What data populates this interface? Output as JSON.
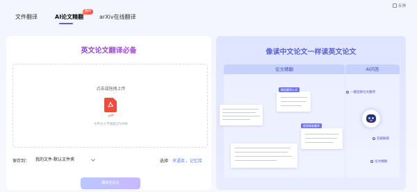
{
  "header": {
    "tabs": [
      {
        "label": "文件翻译"
      },
      {
        "label": "AI论文精翻",
        "active": true
      },
      {
        "label": "arXiv在线翻译"
      }
    ],
    "badge": "限时",
    "feedback": "反馈"
  },
  "left": {
    "title": "英文论文翻译必备",
    "drop_text": "点击或拖拽上传",
    "file_type": "pdf",
    "size_note": "文件大小不能超过50MB",
    "save_label": "保存到：",
    "save_value": "我的文件-默认文件夹",
    "choose_label": "选择",
    "choose_link1": "术语库",
    "choose_link2": "记忆库",
    "translate_button": "翻译全论文"
  },
  "right": {
    "title": "像读中文论文一样读英文论文",
    "translate_header": "论文精翻",
    "qa_header": "AI问答",
    "tag1": "精准翻译公式",
    "tag2": "图表精准翻译",
    "qa_items": [
      "一键选择论文翻译",
      "答疑解惑",
      "论文精翻"
    ]
  },
  "colors": {
    "accent": "#5b5bf0",
    "title_gradient_start": "#7a3cf0",
    "title_gradient_end": "#c34fd8",
    "right_title": "#5a63d6",
    "link": "#4a7cff",
    "pdf_red": "#f24a3c"
  },
  "icons": {
    "feedback": "feedback-icon",
    "file": "pdf-file-icon",
    "chevron": "chevron-down-icon",
    "robot": "robot-icon"
  }
}
